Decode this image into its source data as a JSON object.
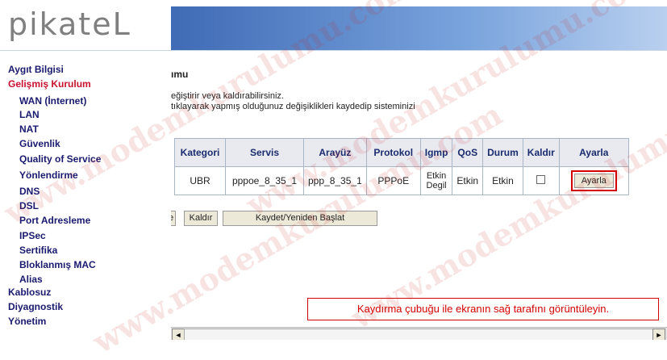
{
  "logo": "pikateL",
  "sidebar": {
    "items": [
      {
        "label": "Aygıt Bilgisi",
        "level": 1
      },
      {
        "label": "Gelişmiş Kurulum",
        "level": 1,
        "active": true
      },
      {
        "label": "WAN (İnternet)",
        "level": 2
      },
      {
        "label": "LAN",
        "level": 2
      },
      {
        "label": "NAT",
        "level": 2
      },
      {
        "label": "Güvenlik",
        "level": 2
      },
      {
        "label": "Quality of Service",
        "level": 2
      },
      {
        "label": "Yönlendirme",
        "level": 2
      },
      {
        "label": "DNS",
        "level": 2
      },
      {
        "label": "DSL",
        "level": 2
      },
      {
        "label": "Port Adresleme",
        "level": 2
      },
      {
        "label": "IPSec",
        "level": 2
      },
      {
        "label": "Sertifika",
        "level": 2
      },
      {
        "label": "Bloklanmış MAC",
        "level": 2
      },
      {
        "label": "Alias",
        "level": 2
      },
      {
        "label": "Kablosuz",
        "level": 1
      },
      {
        "label": "Diyagnostik",
        "level": 1
      },
      {
        "label": "Yönetim",
        "level": 1
      }
    ]
  },
  "main": {
    "title": "ımu",
    "desc_line1": "eğiştirir veya kaldırabilirsiniz.",
    "desc_line2": " tıklayarak yapmış olduğunuz değişiklikleri kaydedip sisteminizi",
    "table": {
      "headers": [
        "Kategori",
        "Servis",
        "Arayüz",
        "Protokol",
        "Igmp",
        "QoS",
        "Durum",
        "Kaldır",
        "Ayarla"
      ],
      "row": {
        "kategori": "UBR",
        "servis": "pppoe_8_35_1",
        "arayuz": "ppp_8_35_1",
        "protokol": "PPPoE",
        "igmp_1": "Etkin",
        "igmp_2": "Degil",
        "qos": "Etkin",
        "durum": "Etkin",
        "ayarla_button": "Ayarla"
      }
    },
    "buttons": {
      "partial": "e",
      "kaldir": "Kaldır",
      "kaydet": "Kaydet/Yeniden Başlat"
    },
    "note": "Kaydırma çubuğu ile ekranın sağ tarafını görüntüleyin."
  },
  "scrollbar": {
    "left_arrow": "◄",
    "right_arrow": "►"
  },
  "watermark": "www.modemkurulumu.com",
  "colors": {
    "accent_red": "#d40000",
    "menu_active": "#c8102e",
    "menu": "#1a1a6e",
    "banner": "#3f6bb6"
  }
}
